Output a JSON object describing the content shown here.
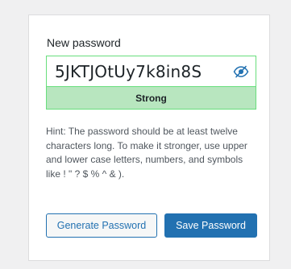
{
  "form": {
    "label": "New password",
    "password_value": "5JKTJOtUy7k8in8S",
    "strength_label": "Strong",
    "hint_text": "Hint: The password should be at least twelve characters long. To make it stronger, use upper and lower case letters, numbers, and symbols like ! \" ? $ % ^ & ).",
    "generate_label": "Generate Password",
    "save_label": "Save Password",
    "toggle_icon": "eye-slash-icon"
  },
  "colors": {
    "accent": "#2271b1",
    "strong_bg": "#b8e6bf",
    "strong_border": "#68de7c"
  }
}
